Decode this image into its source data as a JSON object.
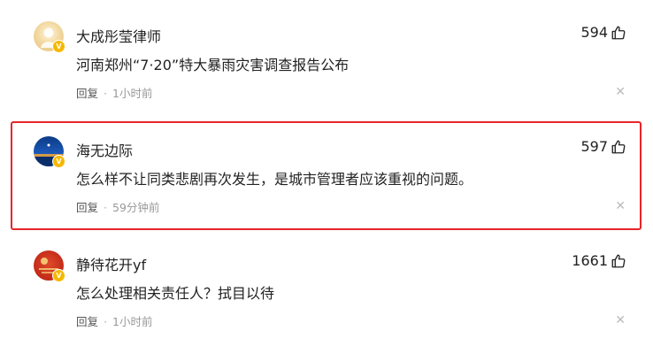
{
  "comments": [
    {
      "username": "大成彤莹律师",
      "likes": "594",
      "text": "河南郑州“7·20”特大暴雨灾害调查报告公布",
      "reply_label": "回复",
      "time": "1小时前",
      "avatar_color": "#f2dca8"
    },
    {
      "username": "海无边际",
      "likes": "597",
      "text": "怎么样不让同类悲剧再次发生，是城市管理者应该重视的问题。",
      "reply_label": "回复",
      "time": "59分钟前",
      "avatar_color": "#1b4fa0"
    },
    {
      "username": "静待花开yf",
      "likes": "1661",
      "text": "怎么处理相关责任人？拭目以待",
      "reply_label": "回复",
      "time": "1小时前",
      "avatar_color": "#c9301c"
    }
  ],
  "colors": {
    "highlight_border": "#e8252a",
    "verified_badge": "#f5b800"
  },
  "icons": {
    "like": "thumbs-up-icon",
    "close": "close-icon",
    "verified": "verified-badge-icon"
  }
}
